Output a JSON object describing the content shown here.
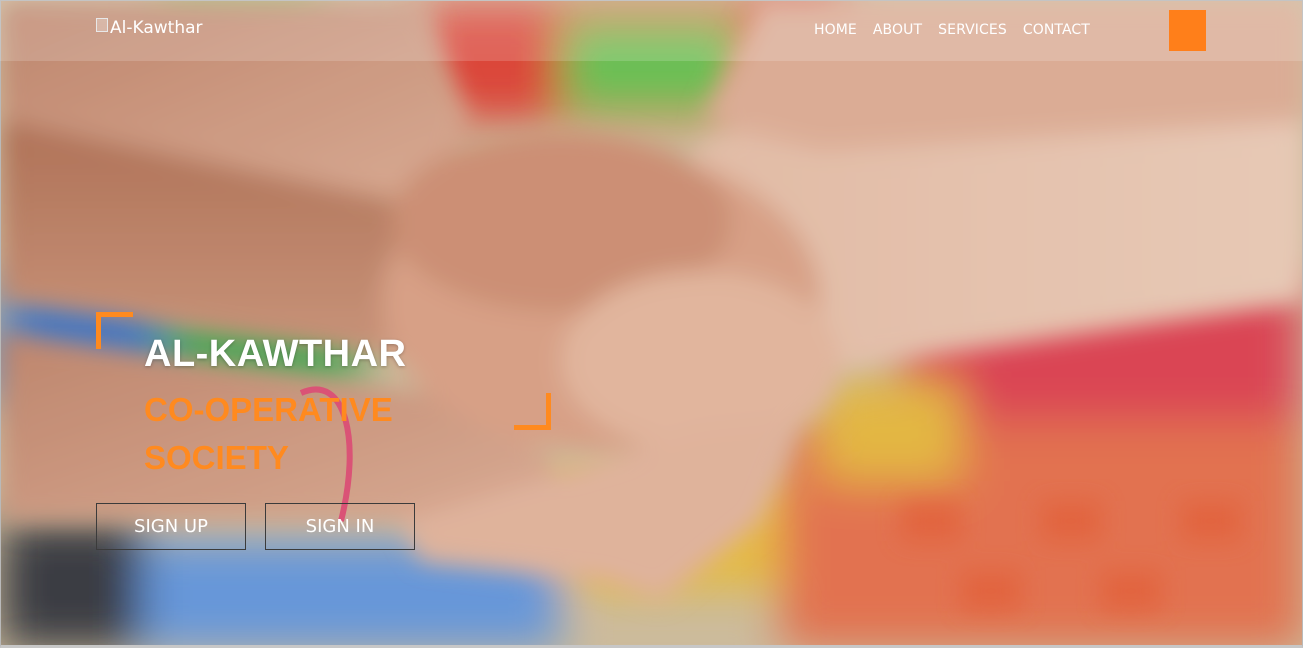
{
  "logo": {
    "alt_text": "Al-Kawthar"
  },
  "nav": {
    "items": [
      "HOME",
      "ABOUT",
      "SERVICES",
      "CONTACT"
    ]
  },
  "hero": {
    "title": "AL-KAWTHAR",
    "subtitle": "CO-OPERATIVE SOCIETY",
    "sign_up_label": "SIGN UP",
    "sign_in_label": "SIGN IN"
  },
  "colors": {
    "accent": "#ff8a1f",
    "menu_button": "#ff7f1a",
    "text": "#ffffff"
  },
  "icons": {
    "menu_button": "menu-icon",
    "logo": "broken-image-icon"
  }
}
